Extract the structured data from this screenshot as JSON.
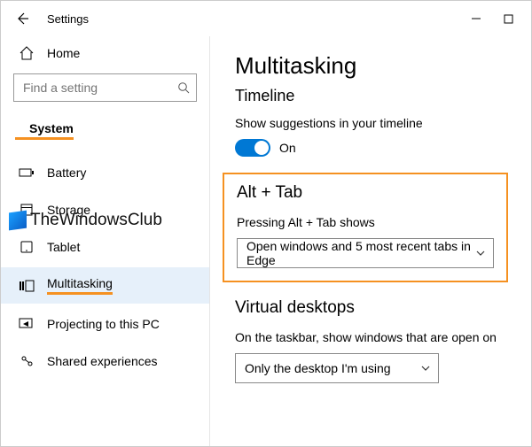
{
  "window": {
    "title": "Settings"
  },
  "sidebar": {
    "home_label": "Home",
    "search_placeholder": "Find a setting",
    "category_label": "System",
    "items": [
      {
        "label": "Battery"
      },
      {
        "label": "Storage"
      },
      {
        "label": "Tablet"
      },
      {
        "label": "Multitasking"
      },
      {
        "label": "Projecting to this PC"
      },
      {
        "label": "Shared experiences"
      }
    ]
  },
  "main": {
    "page_title": "Multitasking",
    "timeline": {
      "heading": "Timeline",
      "setting_label": "Show suggestions in your timeline",
      "toggle_state": "On"
    },
    "alttab": {
      "heading": "Alt + Tab",
      "setting_label": "Pressing Alt + Tab shows",
      "selected": "Open windows and 5 most recent tabs in Edge"
    },
    "virtual": {
      "heading": "Virtual desktops",
      "setting_label": "On the taskbar, show windows that are open on",
      "selected": "Only the desktop I'm using"
    }
  },
  "watermark": {
    "text": "TheWindowsClub"
  }
}
